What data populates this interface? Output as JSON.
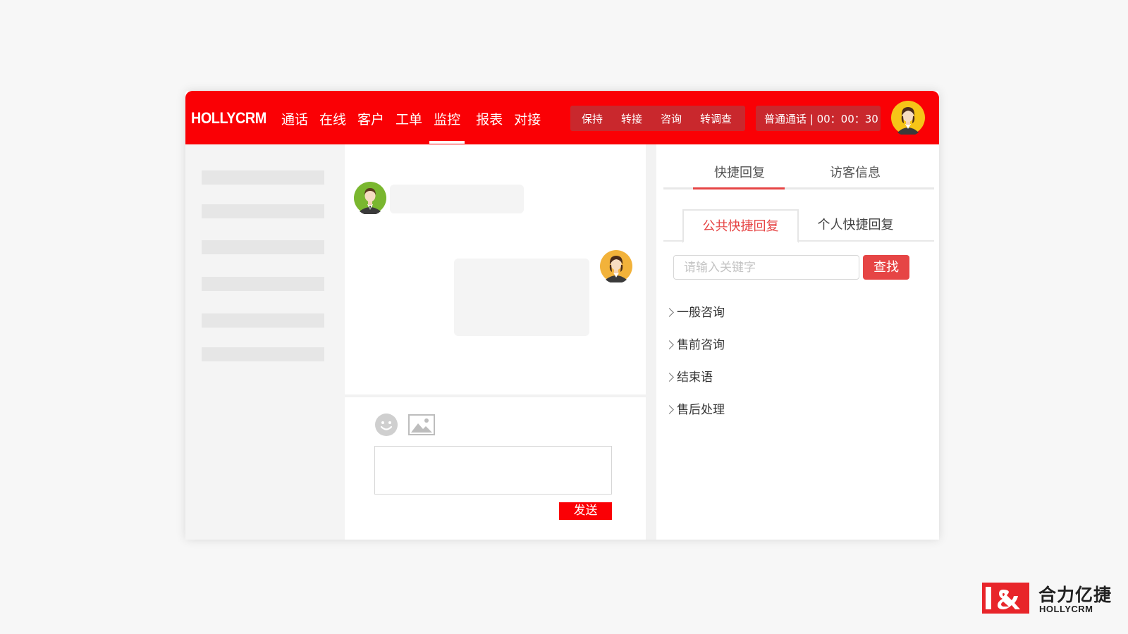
{
  "app": {
    "logo": "HOLLYCRM",
    "nav": [
      {
        "label": "通话"
      },
      {
        "label": "在线"
      },
      {
        "label": "客户"
      },
      {
        "label": "工单"
      },
      {
        "label": "监控",
        "active": true
      },
      {
        "label": "报表"
      },
      {
        "label": "对接"
      }
    ],
    "call_controls": [
      "保持",
      "转接",
      "咨询",
      "转调查"
    ],
    "call_status": "普通通话 | 00：00：30"
  },
  "chat": {
    "send_label": "发送"
  },
  "right_panel": {
    "tabs": [
      "快捷回复",
      "访客信息"
    ],
    "sub_tabs": [
      "公共快捷回复",
      "个人快捷回复"
    ],
    "search_placeholder": "请输入关键字",
    "search_button": "查找",
    "categories": [
      "一般咨询",
      "售前咨询",
      "结束语",
      "售后处理"
    ]
  },
  "brand": {
    "name_cn": "合力亿捷",
    "name_en": "HOLLYCRM"
  },
  "colors": {
    "brand_red": "#fa0005",
    "accent_red": "#e64545",
    "control_bg": "#c9282d"
  }
}
